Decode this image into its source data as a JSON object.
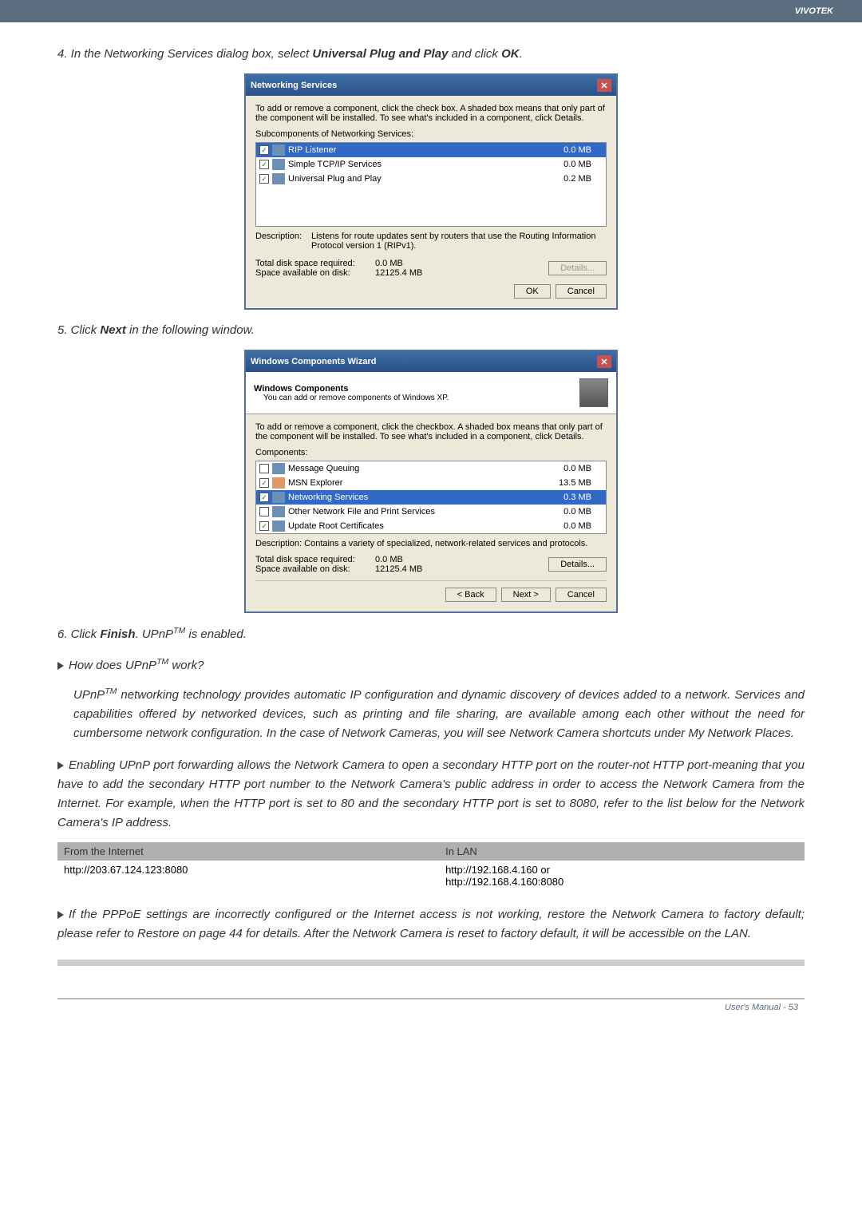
{
  "brand": "VIVOTEK",
  "step4": {
    "prefix": "4. In the Networking Services dialog box, select ",
    "bold": "Universal Plug and Play",
    "mid": " and click ",
    "bold2": "OK",
    "suffix": "."
  },
  "dlg1": {
    "title": "Networking Services",
    "intro": "To add or remove a component, click the check box. A shaded box means that only part of the component will be installed. To see what's included in a component, click Details.",
    "sub_label": "Subcomponents of Networking Services:",
    "rows": [
      {
        "name": "RIP Listener",
        "size": "0.0 MB"
      },
      {
        "name": "Simple TCP/IP Services",
        "size": "0.0 MB"
      },
      {
        "name": "Universal Plug and Play",
        "size": "0.2 MB"
      }
    ],
    "desc_label": "Description:",
    "desc": "Listens for route updates sent by routers that use the Routing Information Protocol version 1 (RIPv1).",
    "disk_req_l": "Total disk space required:",
    "disk_req_v": "0.0 MB",
    "disk_av_l": "Space available on disk:",
    "disk_av_v": "12125.4 MB",
    "details": "Details...",
    "ok": "OK",
    "cancel": "Cancel"
  },
  "step5": {
    "prefix": "5. Click ",
    "bold": "Next",
    "suffix": " in the following window."
  },
  "dlg2": {
    "title": "Windows Components Wizard",
    "hdr": "Windows Components",
    "hdrsub": "You can add or remove components of Windows XP.",
    "intro": "To add or remove a component, click the checkbox. A shaded box means that only part of the component will be installed. To see what's included in a component, click Details.",
    "comp_label": "Components:",
    "rows": [
      {
        "name": "Message Queuing",
        "size": "0.0 MB",
        "chk": false
      },
      {
        "name": "MSN Explorer",
        "size": "13.5 MB",
        "chk": true
      },
      {
        "name": "Networking Services",
        "size": "0.3 MB",
        "chk": true,
        "sel": true
      },
      {
        "name": "Other Network File and Print Services",
        "size": "0.0 MB",
        "chk": false
      },
      {
        "name": "Update Root Certificates",
        "size": "0.0 MB",
        "chk": true
      }
    ],
    "desc": "Description:  Contains a variety of specialized, network-related services and protocols.",
    "disk_req_l": "Total disk space required:",
    "disk_req_v": "0.0 MB",
    "disk_av_l": "Space available on disk:",
    "disk_av_v": "12125.4 MB",
    "details": "Details...",
    "back": "< Back",
    "next": "Next >",
    "cancel": "Cancel"
  },
  "step6": {
    "prefix": "6. Click ",
    "bold": "Finish",
    "suffix_a": ". UPnP",
    "tm": "TM",
    "suffix_b": " is enabled."
  },
  "q": {
    "prefix": "How does UPnP",
    "tm": "TM",
    "suffix": " work?"
  },
  "para_upnp_a": "UPnP",
  "para_upnp_tm": "TM",
  "para_upnp_b": " networking technology provides automatic IP configuration and dynamic discovery of devices added to a network. Services and capabilities offered by networked devices, such as printing and file sharing, are available among each other without the need for cumbersome network configuration. In the case of Network Cameras, you will see Network Camera shortcuts under My Network Places.",
  "para_port": "Enabling UPnP port forwarding allows the Network Camera to open a secondary HTTP port on the router-not HTTP port-meaning that you have to add the secondary HTTP port number to the Network Camera's public address in order to access the Network Camera from the Internet. For example, when the HTTP port is set to 80 and the secondary HTTP port is set to 8080, refer to the list below for the Network Camera's IP address.",
  "table": {
    "h1": "From the Internet",
    "h2": "In LAN",
    "c1": "http://203.67.124.123:8080",
    "c2": "http://192.168.4.160 or\nhttp://192.168.4.160:8080"
  },
  "para_pppoe": "If the PPPoE settings are incorrectly configured or the Internet access is not working, restore the Network Camera to factory default; please refer to Restore on page 44 for details. After the Network Camera is reset to factory default, it will be accessible on the LAN.",
  "footer": "User's Manual - 53"
}
